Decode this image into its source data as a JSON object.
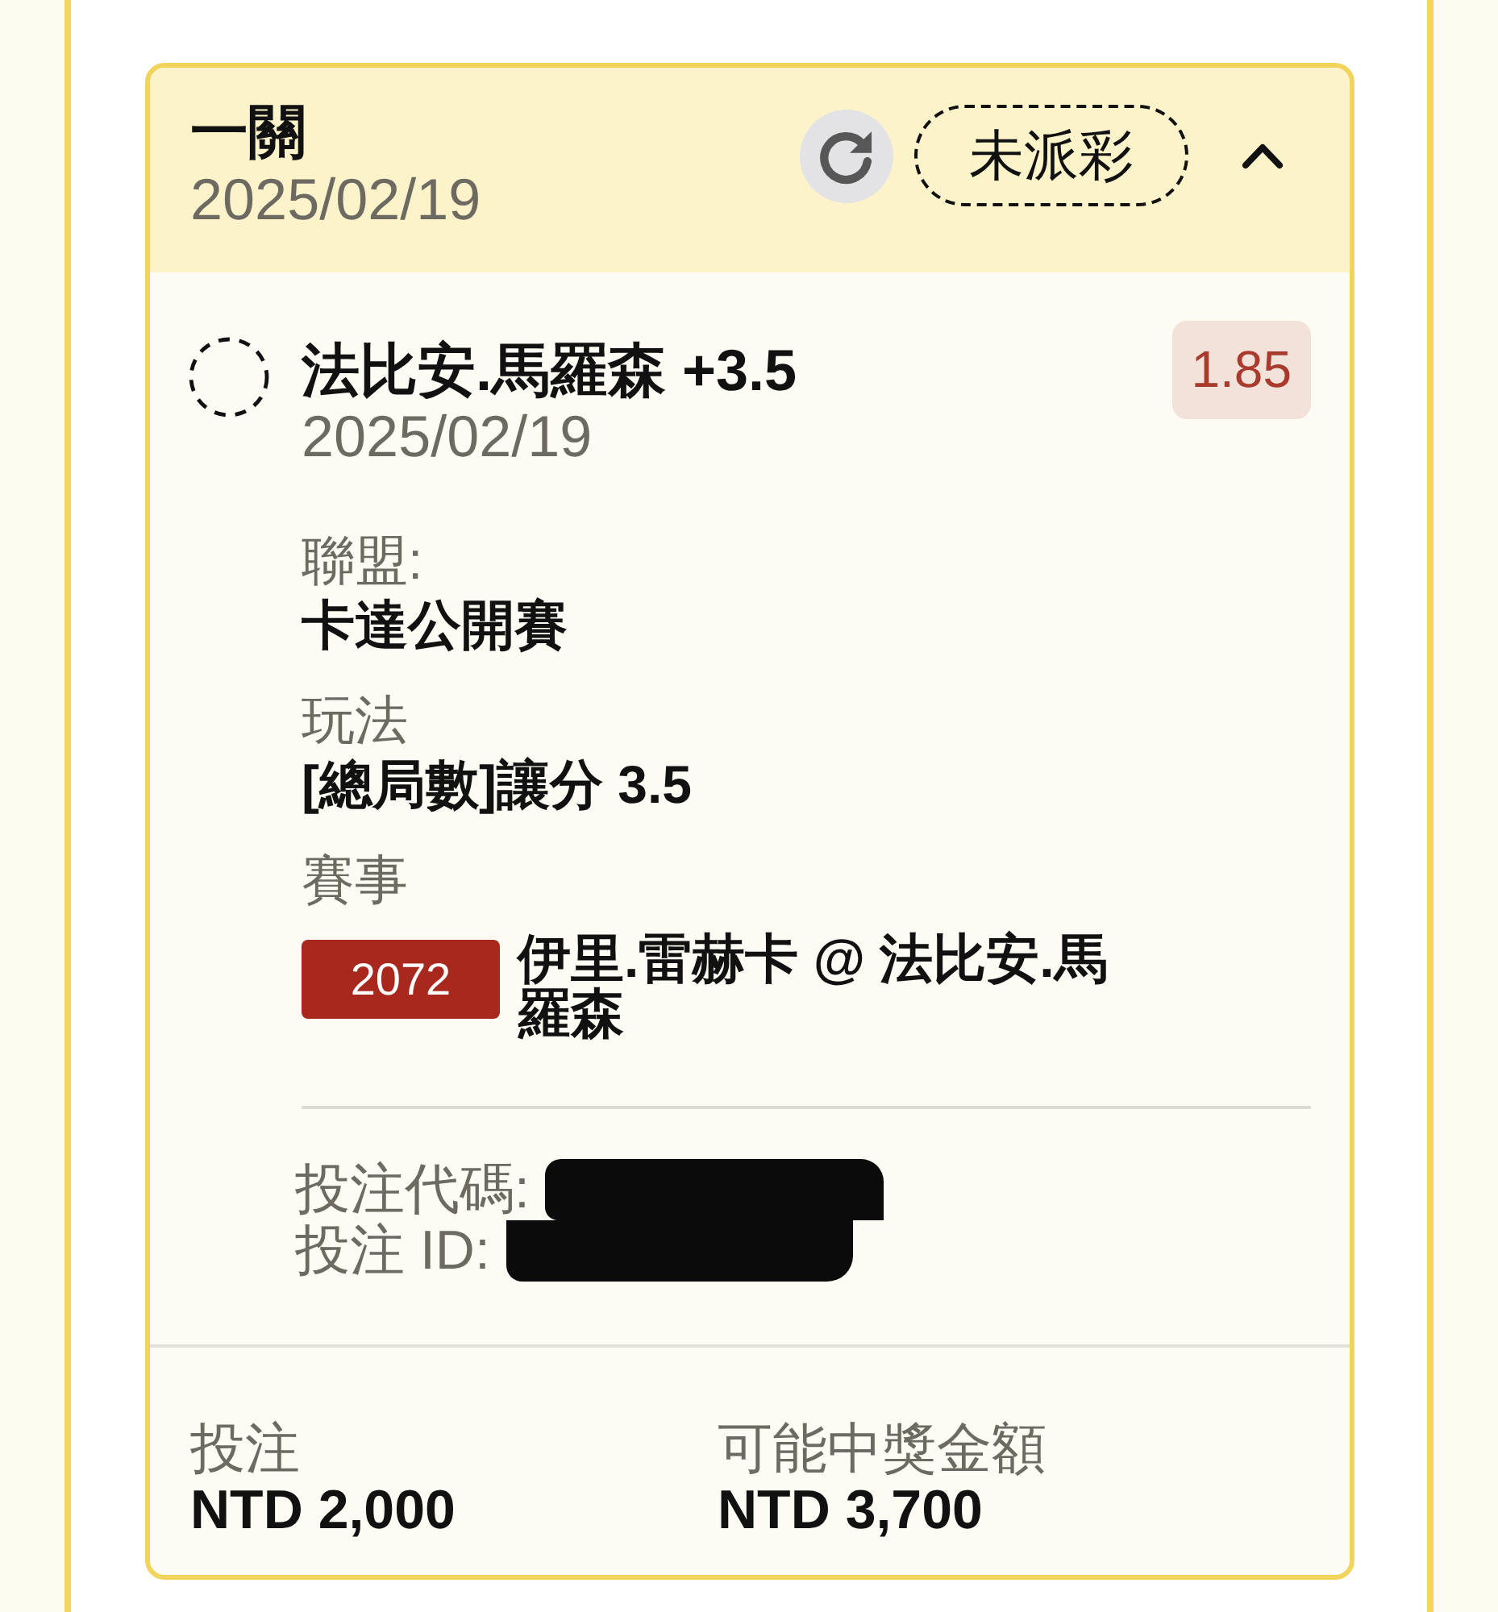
{
  "bet_card": {
    "header": {
      "title": "一關",
      "date": "2025/02/19",
      "status": "未派彩",
      "expanded": true
    },
    "selection": {
      "settled": false,
      "title": "法比安.馬羅森 +3.5",
      "date": "2025/02/19",
      "odds": "1.85"
    },
    "details": [
      {
        "kind": "text",
        "label": "聯盟:",
        "value": "卡達公開賽"
      },
      {
        "kind": "text",
        "label": "玩法",
        "value": "[總局數]讓分 3.5"
      },
      {
        "kind": "match",
        "label": "賽事",
        "code": "2072",
        "value": "伊里.雷赫卡 @ 法比安.馬羅森"
      }
    ],
    "references": [
      {
        "label": "投注代碼:"
      },
      {
        "label": "投注 ID:"
      }
    ],
    "summary": [
      {
        "label": "投注",
        "value": "NTD 2,000"
      },
      {
        "label": "可能中獎金額",
        "value": "NTD 3,700"
      }
    ]
  }
}
